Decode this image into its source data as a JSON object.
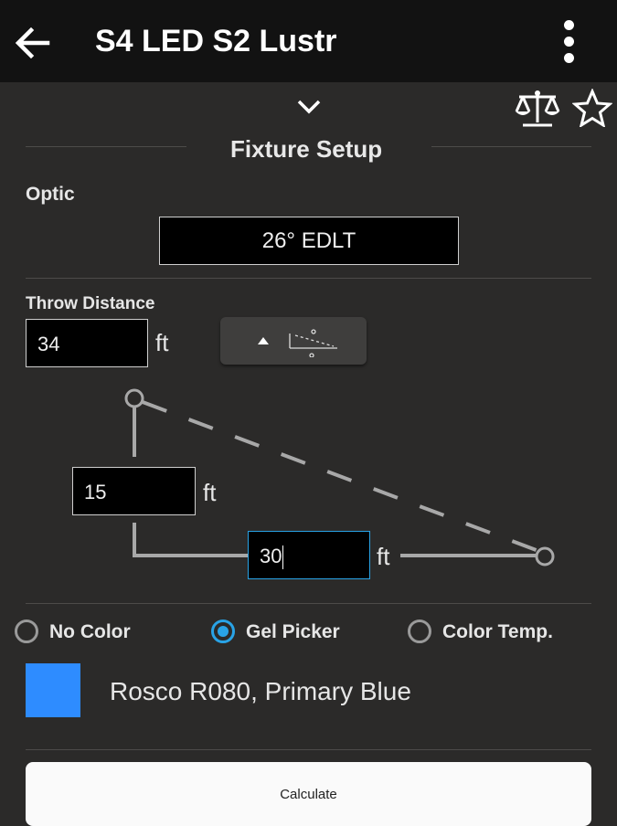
{
  "app_bar": {
    "title": "S4 LED S2 Lustr",
    "back_icon": "arrow-left-icon",
    "menu_icon": "more-vert-icon"
  },
  "toolbar": {
    "collapse_icon": "chevron-down-icon",
    "compare_icon": "scale-icon",
    "favorite_icon": "star-outline-icon"
  },
  "section": {
    "title": "Fixture Setup"
  },
  "optic": {
    "label": "Optic",
    "value": "26° EDLT"
  },
  "throw": {
    "label": "Throw Distance",
    "distance_value": "34",
    "distance_unit": "ft",
    "diagram_toggle_icon": "caret-up-throw-diagram-icon",
    "height_value": "15",
    "height_unit": "ft",
    "horizontal_value": "30",
    "horizontal_unit": "ft"
  },
  "color_mode": {
    "options": [
      "No Color",
      "Gel Picker",
      "Color Temp."
    ],
    "selected": "Gel Picker"
  },
  "gel": {
    "name": "Rosco R080, Primary Blue",
    "swatch_color": "#2e8cff"
  },
  "accent_color": "#29a3e6",
  "calculate_label": "Calculate"
}
